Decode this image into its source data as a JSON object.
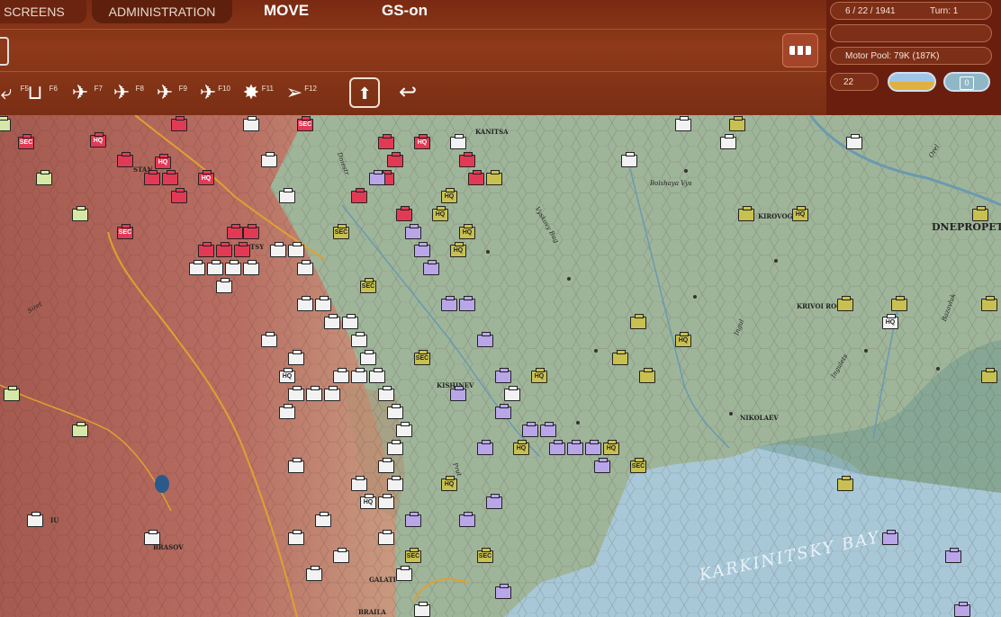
{
  "top_tabs": {
    "screens": "SCREENS",
    "administration": "ADMINISTRATION",
    "move": "MOVE",
    "gs": "GS-on"
  },
  "status": {
    "date": "6 / 22 / 1941",
    "turn": "Turn: 1",
    "motor_pool": "Motor Pool:  79K (187K)",
    "count": "22",
    "counter_value": "0"
  },
  "toolbar": {
    "keys": [
      "F5",
      "F6",
      "F7",
      "F8",
      "F9",
      "F10",
      "F11",
      "F12"
    ]
  },
  "map_labels": {
    "places": [
      "KANITSA",
      "KIROVOGRA",
      "DNEPROPETR",
      "KRIVOI ROG",
      "KISHINEV",
      "NIKOLAEV",
      "GALATI",
      "BRAILA",
      "BRASOV",
      "STAN",
      "TSY",
      "IU"
    ],
    "rivers": [
      "Bolshaya Vys",
      "Vyskovy Bug",
      "Ingul",
      "Ingulets",
      "Dniestr",
      "Prut",
      "Siret",
      "Bazavluk",
      "Orel"
    ],
    "sea": "KARKINITSKY BAY"
  },
  "unit_labels": {
    "hq": "HQ",
    "sec": "SEC"
  },
  "colors": {
    "bar": "#7a2a12",
    "axis": "#e23a55",
    "soviet_white": "#f2f2f2",
    "soviet_blue": "#b8a6e8",
    "water": "#a8c8d8"
  }
}
